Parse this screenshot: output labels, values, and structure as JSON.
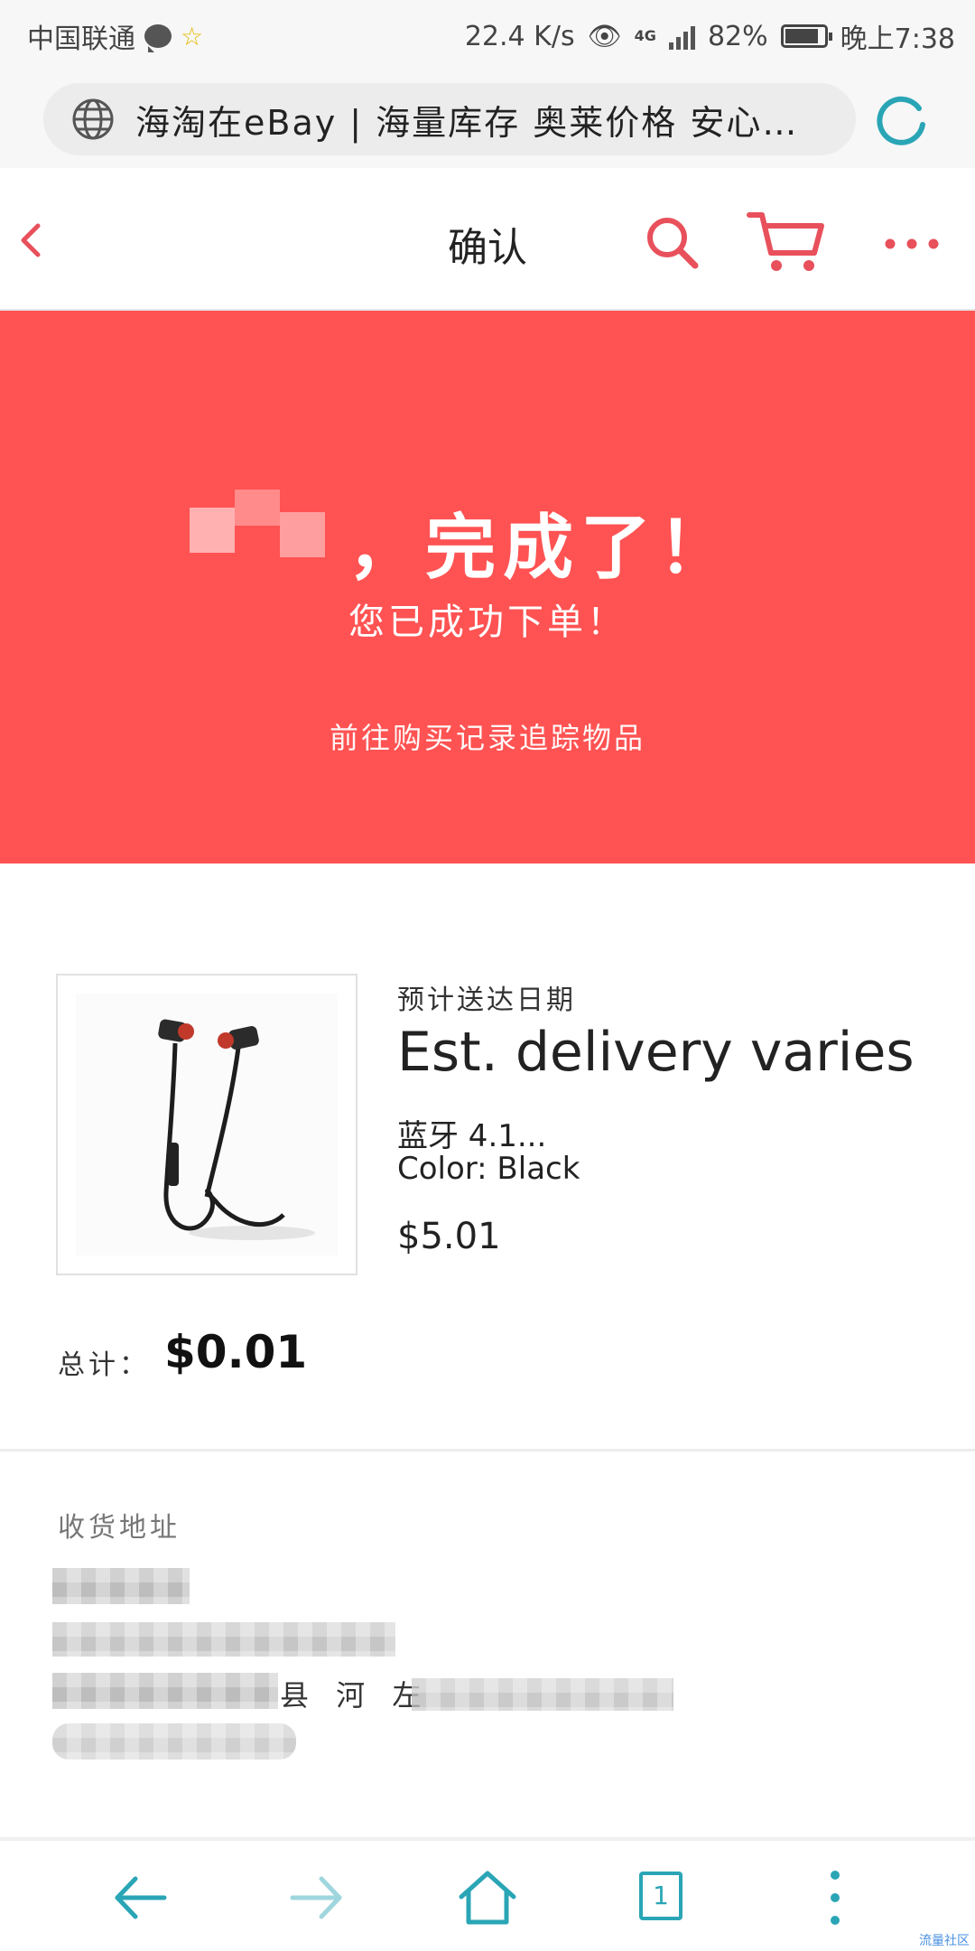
{
  "status_bar": {
    "carrier": "中国联通",
    "speed": "22.4 K/s",
    "network": "4G",
    "battery": "82%",
    "time": "晚上7:38"
  },
  "browser": {
    "url_text": "海淘在eBay | 海量库存 奥莱价格 安心…",
    "icons": [
      "globe-icon",
      "reload-icon"
    ]
  },
  "header": {
    "title": "确认",
    "icons": [
      "back-chevron-icon",
      "search-icon",
      "cart-icon",
      "more-icon"
    ]
  },
  "banner": {
    "title": "，完成了！",
    "subtitle": "您已成功下单！",
    "link": "前往购买记录追踪物品",
    "color": "#ff5252"
  },
  "order": {
    "eta_label": "预计送达日期",
    "eta_value": "Est. delivery varies",
    "item_title": "蓝牙 4.1...",
    "item_color": "Color: Black",
    "item_price": "$5.01",
    "total_label": "总计：",
    "total_value": "$0.01"
  },
  "address": {
    "heading": "收货地址",
    "visible_fragment": "县 河 左"
  },
  "bottom_nav": {
    "tab_count": "1",
    "accent": "#2aa5b6"
  },
  "watermark": "流量社区"
}
